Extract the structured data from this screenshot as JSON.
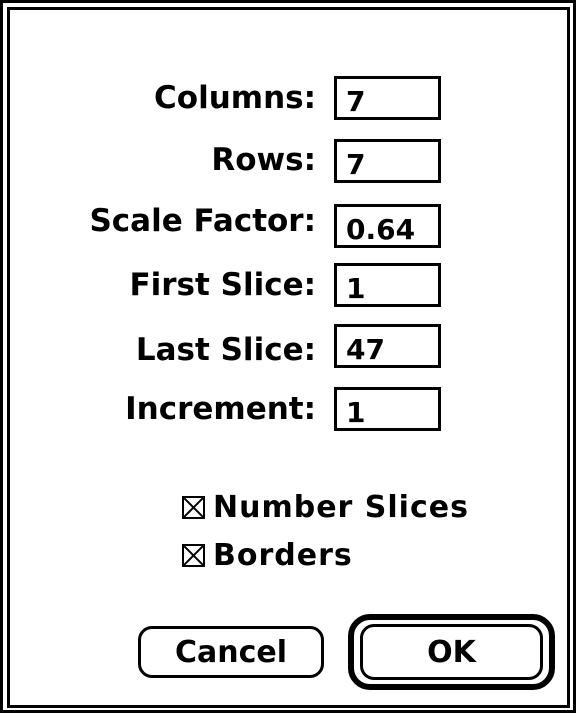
{
  "dialog": {
    "fields": [
      {
        "label": "Columns:",
        "value": "7"
      },
      {
        "label": "Rows:",
        "value": "7"
      },
      {
        "label": "Scale Factor:",
        "value": "0.64"
      },
      {
        "label": "First Slice:",
        "value": "1"
      },
      {
        "label": "Last Slice:",
        "value": "47"
      },
      {
        "label": "Increment:",
        "value": "1"
      }
    ],
    "checkboxes": [
      {
        "label": "Number Slices",
        "checked": true
      },
      {
        "label": "Borders",
        "checked": true
      }
    ],
    "buttons": {
      "cancel_label": "Cancel",
      "ok_label": "OK"
    }
  }
}
